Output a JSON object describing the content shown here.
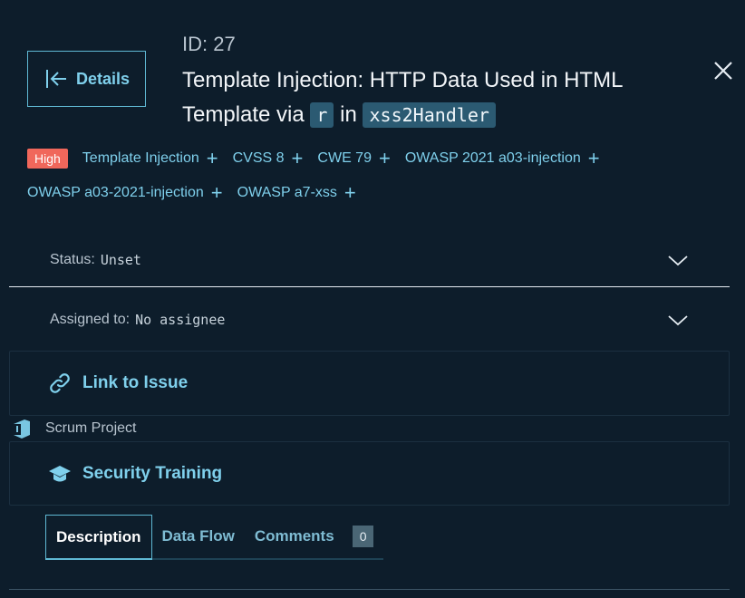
{
  "header": {
    "back_label": "Details",
    "id_label": "ID: 27",
    "title_part1": "Template Injection: HTTP Data Used in HTML Template via",
    "title_code1": "r",
    "title_part2": "in",
    "title_code2": "xss2Handler"
  },
  "tags": {
    "severity": "High",
    "items": [
      "Template Injection",
      "CVSS 8",
      "CWE 79",
      "OWASP 2021 a03-injection",
      "OWASP a03-2021-injection",
      "OWASP a7-xss"
    ]
  },
  "fields": {
    "status_label": "Status:",
    "status_value": "Unset",
    "assigned_label": "Assigned to:",
    "assigned_value": "No assignee"
  },
  "panels": {
    "link_issue": "Link to Issue",
    "scrum_project": "Scrum Project",
    "security_training": "Security Training"
  },
  "tabs": {
    "description": "Description",
    "data_flow": "Data Flow",
    "comments": "Comments",
    "comments_count": "0"
  },
  "colors": {
    "background": "#0d1d2b",
    "accent": "#7fd0ec",
    "severity_high": "#f0675b",
    "code_bg": "#2b5a72"
  }
}
